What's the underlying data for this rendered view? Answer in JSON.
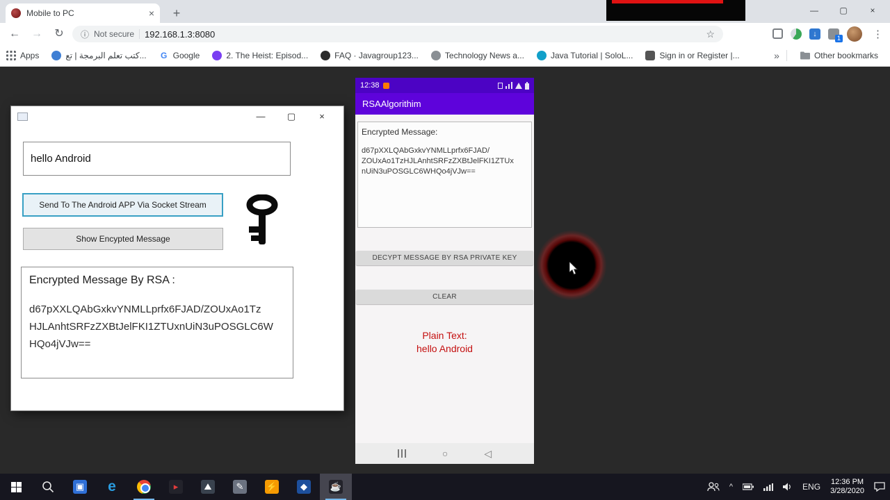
{
  "browser": {
    "tab_title": "Mobile to PC",
    "url_security": "Not secure",
    "url_address": "192.168.1.3:8080",
    "extension_badge": "1",
    "bookmarks": {
      "apps_label": "Apps",
      "items": [
        "كتب تعلم البرمجة | تع...",
        "Google",
        "2. The Heist: Episod...",
        "FAQ · Javagroup123...",
        "Technology News a...",
        "Java Tutorial | SoloL...",
        "Sign in or Register |..."
      ],
      "other_label": "Other bookmarks"
    }
  },
  "winforms_app": {
    "message_input": "hello Android",
    "send_button": "Send To The Android APP Via Socket Stream",
    "show_button": "Show Encypted Message",
    "result_title": "Encrypted Message By RSA :",
    "result_lines": [
      "d67pXXLQAbGxkvYNMLLprfx6FJAD/ZOUxAo1Tz",
      "HJLAnhtSRFzZXBtJelFKI1ZTUxnUiN3uPOSGLC6W",
      "HQo4jVJw=="
    ]
  },
  "android_app": {
    "status_time": "12:38",
    "app_title": "RSAAlgorithim",
    "encrypted_label": "Encrypted Message:",
    "encrypted_lines": [
      "d67pXXLQAbGxkvYNMLLprfx6FJAD/",
      "ZOUxAo1TzHJLAnhtSRFzZXBtJelFKI1ZTUx",
      "nUiN3uPOSGLC6WHQo4jVJw=="
    ],
    "decrypt_button": "DECYPT MESSAGE BY RSA PRIVATE KEY",
    "clear_button": "CLEAR",
    "plain_label": "Plain Text:",
    "plain_value": "hello Android"
  },
  "taskbar": {
    "language": "ENG",
    "time": "12:36 PM",
    "date": "3/28/2020"
  },
  "icons": {
    "back": "←",
    "forward": "→",
    "refresh": "↻",
    "info": "ⓘ",
    "star": "☆",
    "menu": "⋮",
    "tab_close": "×",
    "new_tab": "+",
    "win_minimize": "—",
    "win_maximize": "▢",
    "win_close": "×",
    "form_minimize": "—",
    "form_maximize": "▢",
    "form_close": "×",
    "overflow_chevron": "»",
    "tray_caret": "^",
    "nav_home": "○",
    "nav_back": "◁"
  }
}
